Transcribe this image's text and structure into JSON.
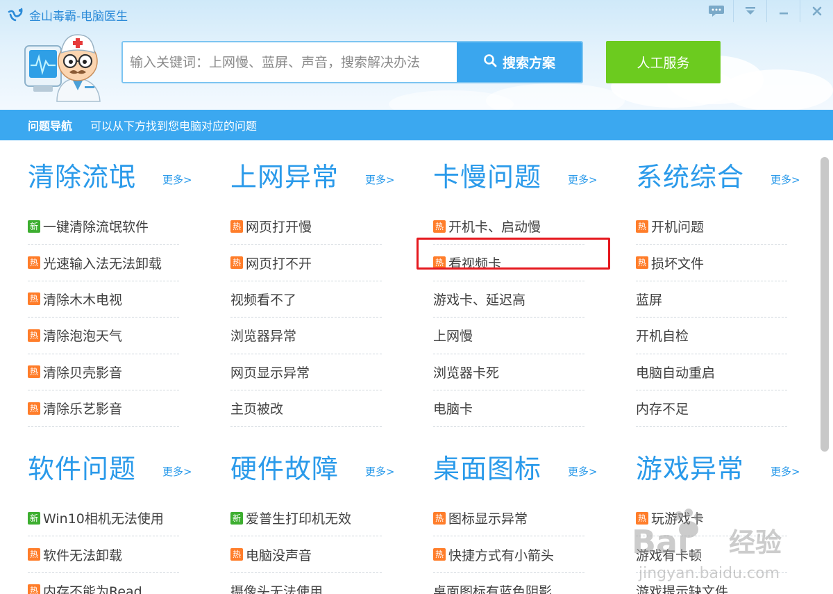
{
  "app": {
    "title": "金山毒霸-电脑医生"
  },
  "search": {
    "placeholder": "输入关键词：上网慢、蓝屏、声音，搜索解决办法",
    "button_label": "搜索方案"
  },
  "service_button": "人工服务",
  "nav": {
    "title": "问题导航",
    "description": "可以从下方找到您电脑对应的问题"
  },
  "more_label": "更多>",
  "badges": {
    "hot": "热",
    "new": "新"
  },
  "colors": {
    "accent": "#2a9aea",
    "nav_bar": "#3ba8f0",
    "search_button": "#3aa6ee",
    "service_button": "#6ccb1f",
    "hot_badge": "#ff7d2a",
    "new_badge": "#3dae30",
    "highlight_box": "#e5181e"
  },
  "highlighted_item": "看视频卡",
  "categories": [
    {
      "title": "清除流氓",
      "items": [
        {
          "label": "一键清除流氓软件",
          "badge": "new"
        },
        {
          "label": "光速输入法无法卸载",
          "badge": "hot"
        },
        {
          "label": "清除木木电视",
          "badge": "hot"
        },
        {
          "label": "清除泡泡天气",
          "badge": "hot"
        },
        {
          "label": "清除贝壳影音",
          "badge": "hot"
        },
        {
          "label": "清除乐艺影音",
          "badge": "hot"
        }
      ]
    },
    {
      "title": "上网异常",
      "items": [
        {
          "label": "网页打开慢",
          "badge": "hot"
        },
        {
          "label": "网页打不开",
          "badge": "hot"
        },
        {
          "label": "视频看不了",
          "badge": null
        },
        {
          "label": "浏览器异常",
          "badge": null
        },
        {
          "label": "网页显示异常",
          "badge": null
        },
        {
          "label": "主页被改",
          "badge": null
        }
      ]
    },
    {
      "title": "卡慢问题",
      "items": [
        {
          "label": "开机卡、启动慢",
          "badge": "hot"
        },
        {
          "label": "看视频卡",
          "badge": "hot"
        },
        {
          "label": "游戏卡、延迟高",
          "badge": null
        },
        {
          "label": "上网慢",
          "badge": null
        },
        {
          "label": "浏览器卡死",
          "badge": null
        },
        {
          "label": "电脑卡",
          "badge": null
        }
      ]
    },
    {
      "title": "系统综合",
      "items": [
        {
          "label": "开机问题",
          "badge": "hot"
        },
        {
          "label": "损坏文件",
          "badge": "hot"
        },
        {
          "label": "蓝屏",
          "badge": null
        },
        {
          "label": "开机自检",
          "badge": null
        },
        {
          "label": "电脑自动重启",
          "badge": null
        },
        {
          "label": "内存不足",
          "badge": null
        }
      ]
    },
    {
      "title": "软件问题",
      "items": [
        {
          "label": "Win10相机无法使用",
          "badge": "new"
        },
        {
          "label": "软件无法卸载",
          "badge": "hot"
        },
        {
          "label": "内存不能为Read",
          "badge": "hot"
        }
      ]
    },
    {
      "title": "硬件故障",
      "items": [
        {
          "label": "爱普生打印机无效",
          "badge": "new"
        },
        {
          "label": "电脑没声音",
          "badge": "hot"
        },
        {
          "label": "摄像头无法使用",
          "badge": null
        }
      ]
    },
    {
      "title": "桌面图标",
      "items": [
        {
          "label": "图标显示异常",
          "badge": "hot"
        },
        {
          "label": "快捷方式有小箭头",
          "badge": "hot"
        },
        {
          "label": "桌面图标有蓝色阴影",
          "badge": null
        }
      ]
    },
    {
      "title": "游戏异常",
      "items": [
        {
          "label": "玩游戏卡",
          "badge": "hot"
        },
        {
          "label": "游戏有卡顿",
          "badge": null
        },
        {
          "label": "游戏提示缺文件",
          "badge": null
        }
      ]
    }
  ],
  "watermark": {
    "brand": "Bai",
    "brand_cn": "经验",
    "url": "jingyan.baidu.com"
  }
}
